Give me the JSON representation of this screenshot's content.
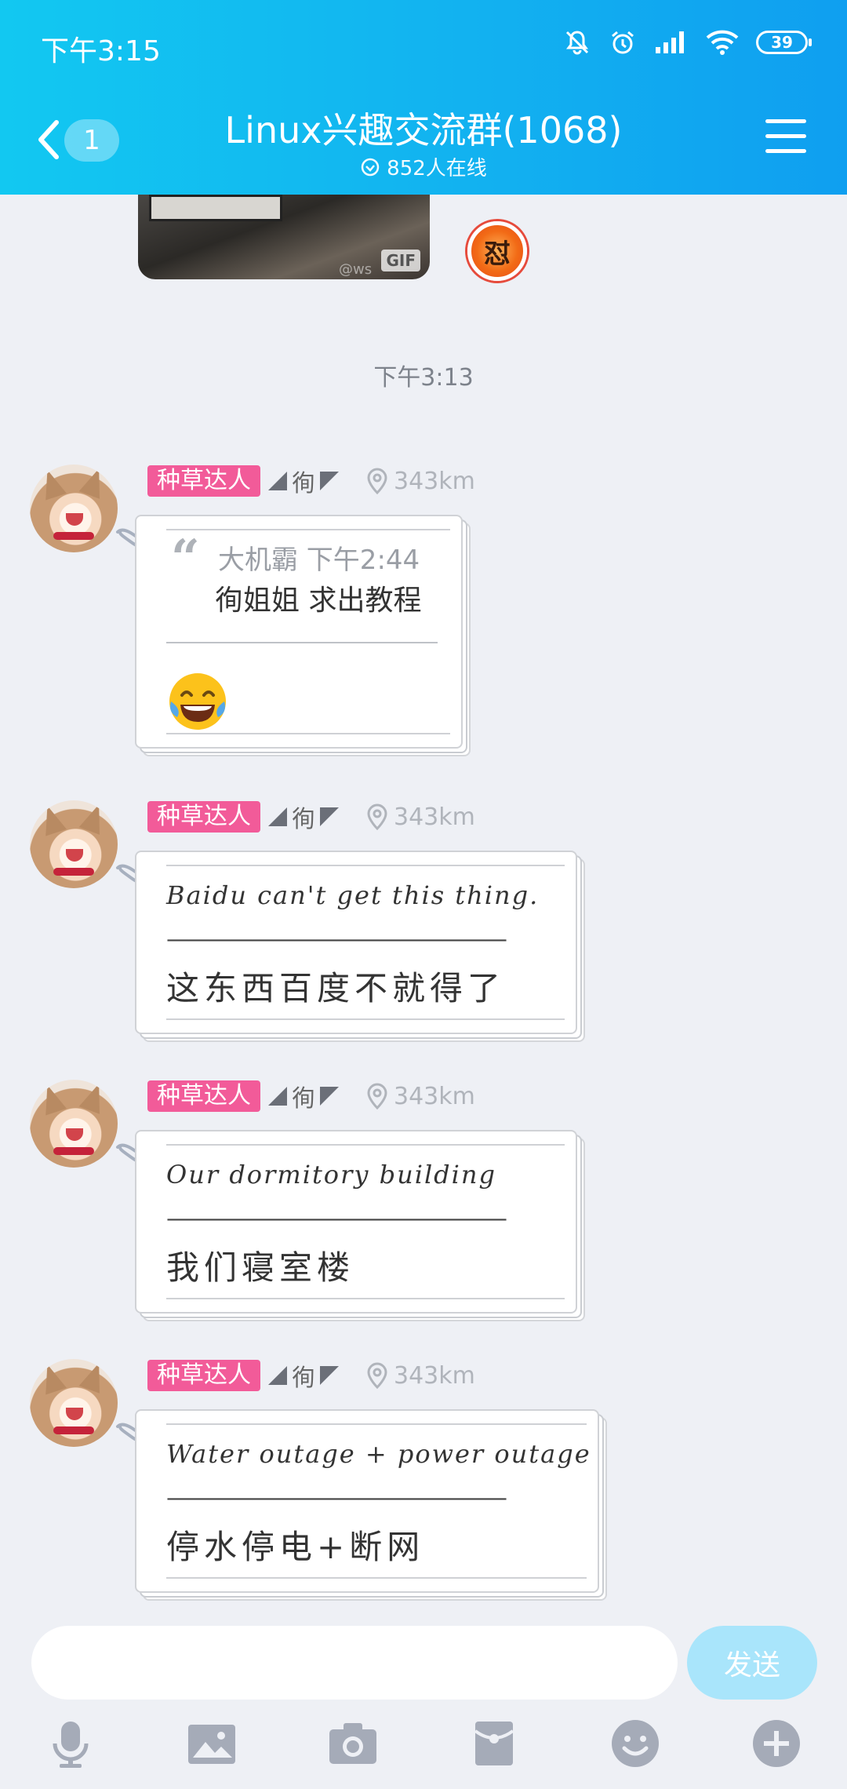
{
  "status_bar": {
    "time": "下午3:15",
    "battery": "39"
  },
  "header": {
    "back_count": "1",
    "title": "Linux兴趣交流群(1068)",
    "online": "852人在线"
  },
  "chat": {
    "gif_tag": "GIF",
    "gif_watermark": "@ws",
    "badge_glyph": "怼",
    "time_divider": "下午3:13",
    "sender": {
      "level_tag": "种草达人",
      "nickname": "徇",
      "distance": "343km"
    },
    "messages": [
      {
        "type": "quote",
        "quote_source": "大机霸 下午2:44",
        "quote_text": "徇姐姐  求出教程",
        "reply_emoji": "tears-of-joy-emoji"
      },
      {
        "type": "note",
        "english": "Baidu can't get this thing.",
        "divider": "————————————————",
        "chinese": "这东西百度不就得了"
      },
      {
        "type": "note",
        "english": "Our dormitory building",
        "divider": "————————————————",
        "chinese": "我们寝室楼"
      },
      {
        "type": "note",
        "english": "Water outage + power outage",
        "divider": "————————————————",
        "chinese": "停水停电+断网"
      }
    ]
  },
  "composer": {
    "placeholder": "",
    "send_label": "发送",
    "tools": [
      "microphone-icon",
      "image-icon",
      "camera-icon",
      "red-packet-icon",
      "emoji-icon",
      "plus-icon"
    ]
  },
  "colors": {
    "header_start": "#12c8f1",
    "header_end": "#0f9ff0",
    "level_tag": "#f25b99",
    "send_button": "#a9e5fb",
    "background": "#eef0f5"
  }
}
